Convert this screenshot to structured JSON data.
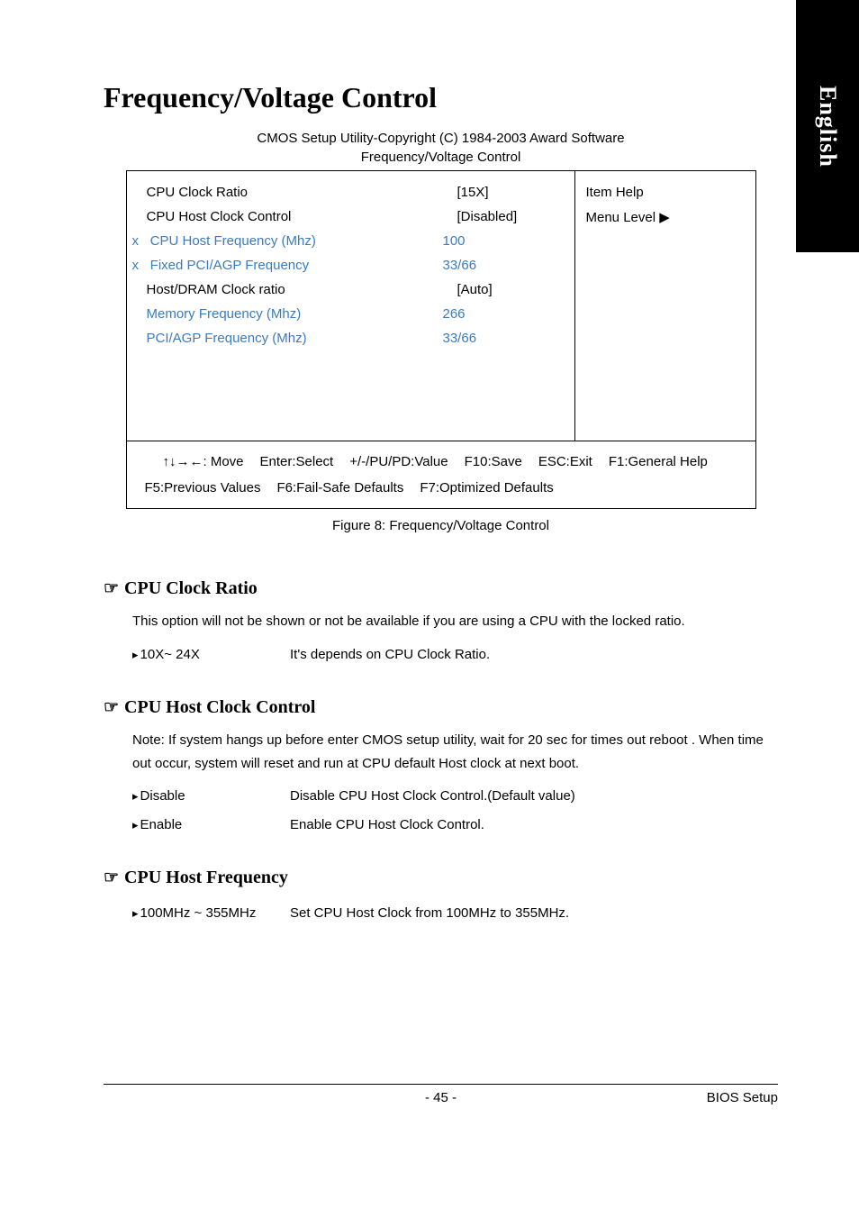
{
  "sideTab": "English",
  "pageTitle": "Frequency/Voltage Control",
  "biosHeader": "CMOS Setup Utility-Copyright (C) 1984-2003 Award Software",
  "biosSubheader": "Frequency/Voltage Control",
  "biosRows": [
    {
      "label": "CPU Clock Ratio",
      "value": "[15X]",
      "disabled": false,
      "prefix": ""
    },
    {
      "label": "CPU Host Clock Control",
      "value": "[Disabled]",
      "disabled": false,
      "prefix": ""
    },
    {
      "label": "CPU Host Frequency (Mhz)",
      "value": "100",
      "disabled": true,
      "prefix": "x"
    },
    {
      "label": "Fixed PCI/AGP Frequency",
      "value": "33/66",
      "disabled": true,
      "prefix": "x"
    },
    {
      "label": "Host/DRAM Clock ratio",
      "value": "[Auto]",
      "disabled": false,
      "prefix": ""
    },
    {
      "label": "Memory Frequency (Mhz)",
      "value": "266",
      "disabled": true,
      "prefix": ""
    },
    {
      "label": "PCI/AGP Frequency (Mhz)",
      "value": "33/66",
      "disabled": true,
      "prefix": ""
    }
  ],
  "helpTitle": "Item Help",
  "helpLevel": "Menu Level",
  "footer": {
    "line1": {
      "move": "↑↓→←: Move",
      "select": "Enter:Select",
      "value": "+/-/PU/PD:Value",
      "save": "F10:Save",
      "exit": "ESC:Exit",
      "help": "F1:General Help"
    },
    "line2": {
      "prev": "F5:Previous Values",
      "fail": "F6:Fail-Safe Defaults",
      "opt": "F7:Optimized Defaults"
    }
  },
  "figureCaption": "Figure 8: Frequency/Voltage Control",
  "sections": [
    {
      "title": "CPU Clock Ratio",
      "body": "This option will not be shown or not be available if you are using a CPU with the locked ratio.",
      "options": [
        {
          "key": "10X~ 24X",
          "desc": "It's depends on CPU Clock Ratio."
        }
      ]
    },
    {
      "title": "CPU Host Clock Control",
      "body": "Note: If system hangs up before enter CMOS setup utility, wait for 20 sec for times out reboot . When time out occur, system will reset and run at CPU default Host clock at next boot.",
      "options": [
        {
          "key": "Disable",
          "desc": "Disable CPU Host Clock Control.(Default value)"
        },
        {
          "key": "Enable",
          "desc": "Enable CPU Host Clock Control."
        }
      ]
    },
    {
      "title": "CPU Host Frequency",
      "body": "",
      "options": [
        {
          "key": "100MHz ~ 355MHz",
          "desc": "Set CPU Host Clock from 100MHz to 355MHz."
        }
      ]
    }
  ],
  "pageNumber": "- 45 -",
  "footerRight": "BIOS Setup"
}
